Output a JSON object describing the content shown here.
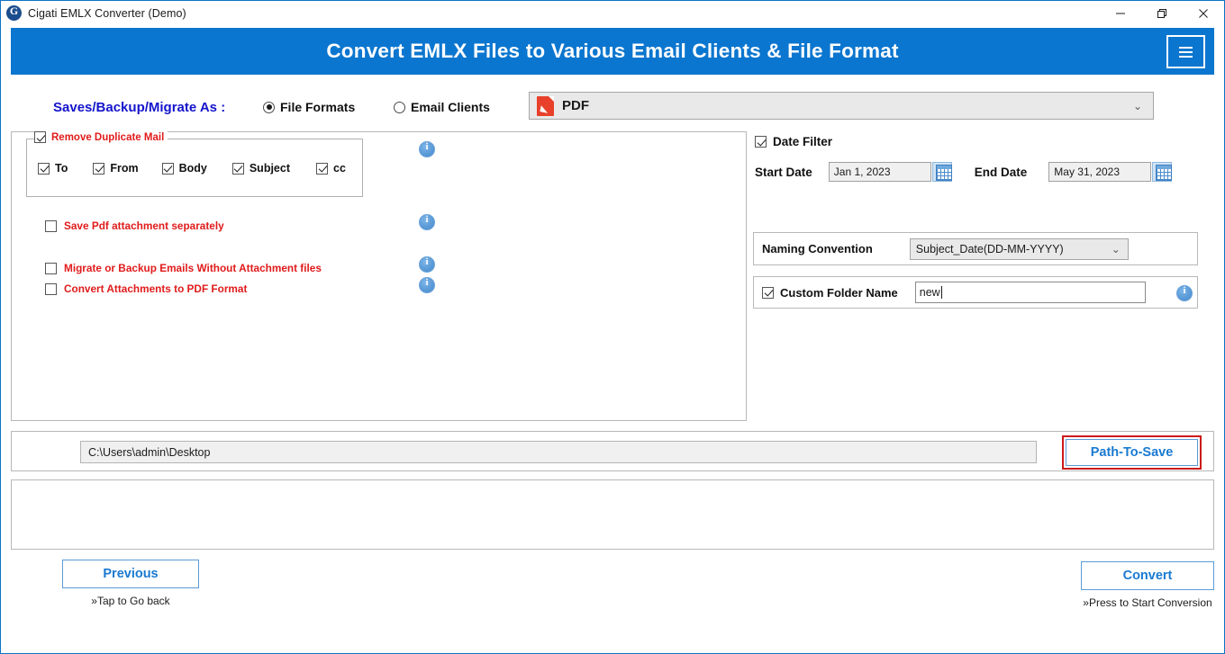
{
  "window": {
    "title": "Cigati EMLX Converter (Demo)",
    "logo_icon": "cigati-logo-icon",
    "controls": {
      "minimize": "minimize-icon",
      "restore": "restore-icon",
      "close": "close-icon"
    }
  },
  "header": {
    "title": "Convert EMLX Files to Various Email Clients & File Format",
    "menu_icon": "hamburger-menu-icon",
    "background_color": "#0b76cf"
  },
  "saves_row": {
    "label": "Saves/Backup/Migrate As :",
    "options": [
      {
        "label": "File Formats",
        "selected": true
      },
      {
        "label": "Email Clients",
        "selected": false
      }
    ],
    "format_select": {
      "value": "PDF",
      "icon": "pdf-file-icon",
      "chevron": "⌄"
    }
  },
  "left_panel": {
    "duplicate_group": {
      "title": "Remove Duplicate Mail",
      "checked": true,
      "items": [
        {
          "label": "To",
          "checked": true
        },
        {
          "label": "From",
          "checked": true
        },
        {
          "label": "Body",
          "checked": true
        },
        {
          "label": "Subject",
          "checked": true
        },
        {
          "label": "cc",
          "checked": true
        }
      ]
    },
    "options": [
      {
        "label": "Save Pdf attachment separately",
        "checked": false
      },
      {
        "label": "Migrate or Backup Emails Without Attachment files",
        "checked": false
      },
      {
        "label": "Convert Attachments to PDF Format",
        "checked": false
      }
    ],
    "info_icons": [
      "info-icon",
      "info-icon",
      "info-icon",
      "info-icon"
    ],
    "label_color": "#e01b1b"
  },
  "right_panel": {
    "date_filter": {
      "label": "Date Filter",
      "checked": true,
      "start_label": "Start Date",
      "start_value": "Jan 1, 2023",
      "end_label": "End Date",
      "end_value": "May 31, 2023",
      "calendar_icon": "calendar-icon"
    },
    "naming_convention": {
      "label": "Naming Convention",
      "value": "Subject_Date(DD-MM-YYYY)",
      "chevron": "⌄"
    },
    "custom_folder": {
      "label": "Custom Folder Name",
      "checked": true,
      "value": "new",
      "info_icon": "info-icon"
    }
  },
  "path_row": {
    "path_value": "C:\\Users\\admin\\Desktop",
    "button_label": "Path-To-Save",
    "highlight_color": "#cc1a1a"
  },
  "footer": {
    "previous": {
      "label": "Previous",
      "caption": "»Tap to Go back"
    },
    "convert": {
      "label": "Convert",
      "caption": "»Press to Start Conversion"
    },
    "accent_color": "#1a7ad1"
  }
}
